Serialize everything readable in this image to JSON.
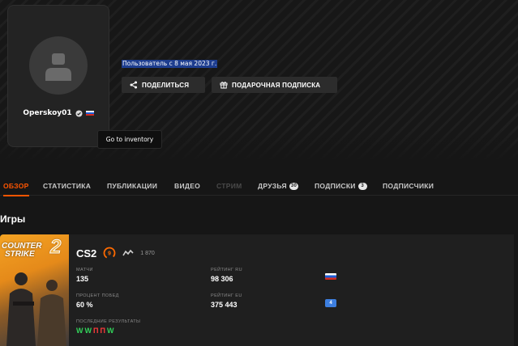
{
  "profile": {
    "username": "Operskoy01",
    "member_since": "Пользователь с 8 мая 2023 г.",
    "country_flag": "russia-flag-icon"
  },
  "actions": {
    "share_label": "ПОДЕЛИТЬСЯ",
    "gift_label": "ПОДАРОЧНАЯ ПОДПИСКА"
  },
  "tooltip": {
    "text": "Go to inventory"
  },
  "tabs": [
    {
      "label": "ОБЗОР",
      "active": true
    },
    {
      "label": "СТАТИСТИКА"
    },
    {
      "label": "ПУБЛИКАЦИИ"
    },
    {
      "label": "ВИДЕО"
    },
    {
      "label": "СТРИМ",
      "disabled": true
    },
    {
      "label": "ДРУЗЬЯ",
      "count": "30"
    },
    {
      "label": "ПОДПИСКИ",
      "count": "3"
    },
    {
      "label": "ПОДПИСЧИКИ"
    }
  ],
  "games_section": {
    "title": "Игры"
  },
  "game": {
    "cover_title_line1": "COUNTER",
    "cover_title_line2": "STRIKE",
    "cover_title_number": "2",
    "name": "CS2",
    "skill_level": "9",
    "elo": "1 870",
    "stats": {
      "matches_label": "МАТЧИ",
      "matches_value": "135",
      "win_rate_label": "ПРОЦЕНТ ПОБЕД",
      "win_rate_value": "60 %",
      "rating_ru_label": "РЕЙТИНГ RU",
      "rating_ru_value": "98 306",
      "rating_eu_label": "РЕЙТИНГ EU",
      "rating_eu_value": "375 443",
      "recent_results_label": "ПОСЛЕДНИЕ РЕЗУЛЬТАТЫ"
    },
    "recent_results": [
      "W",
      "W",
      "П",
      "П",
      "W"
    ],
    "eu_badge": "4"
  },
  "colors": {
    "accent": "#ff5500",
    "win": "#32d35a",
    "loss": "#ff3b3b",
    "background": "#161616"
  }
}
